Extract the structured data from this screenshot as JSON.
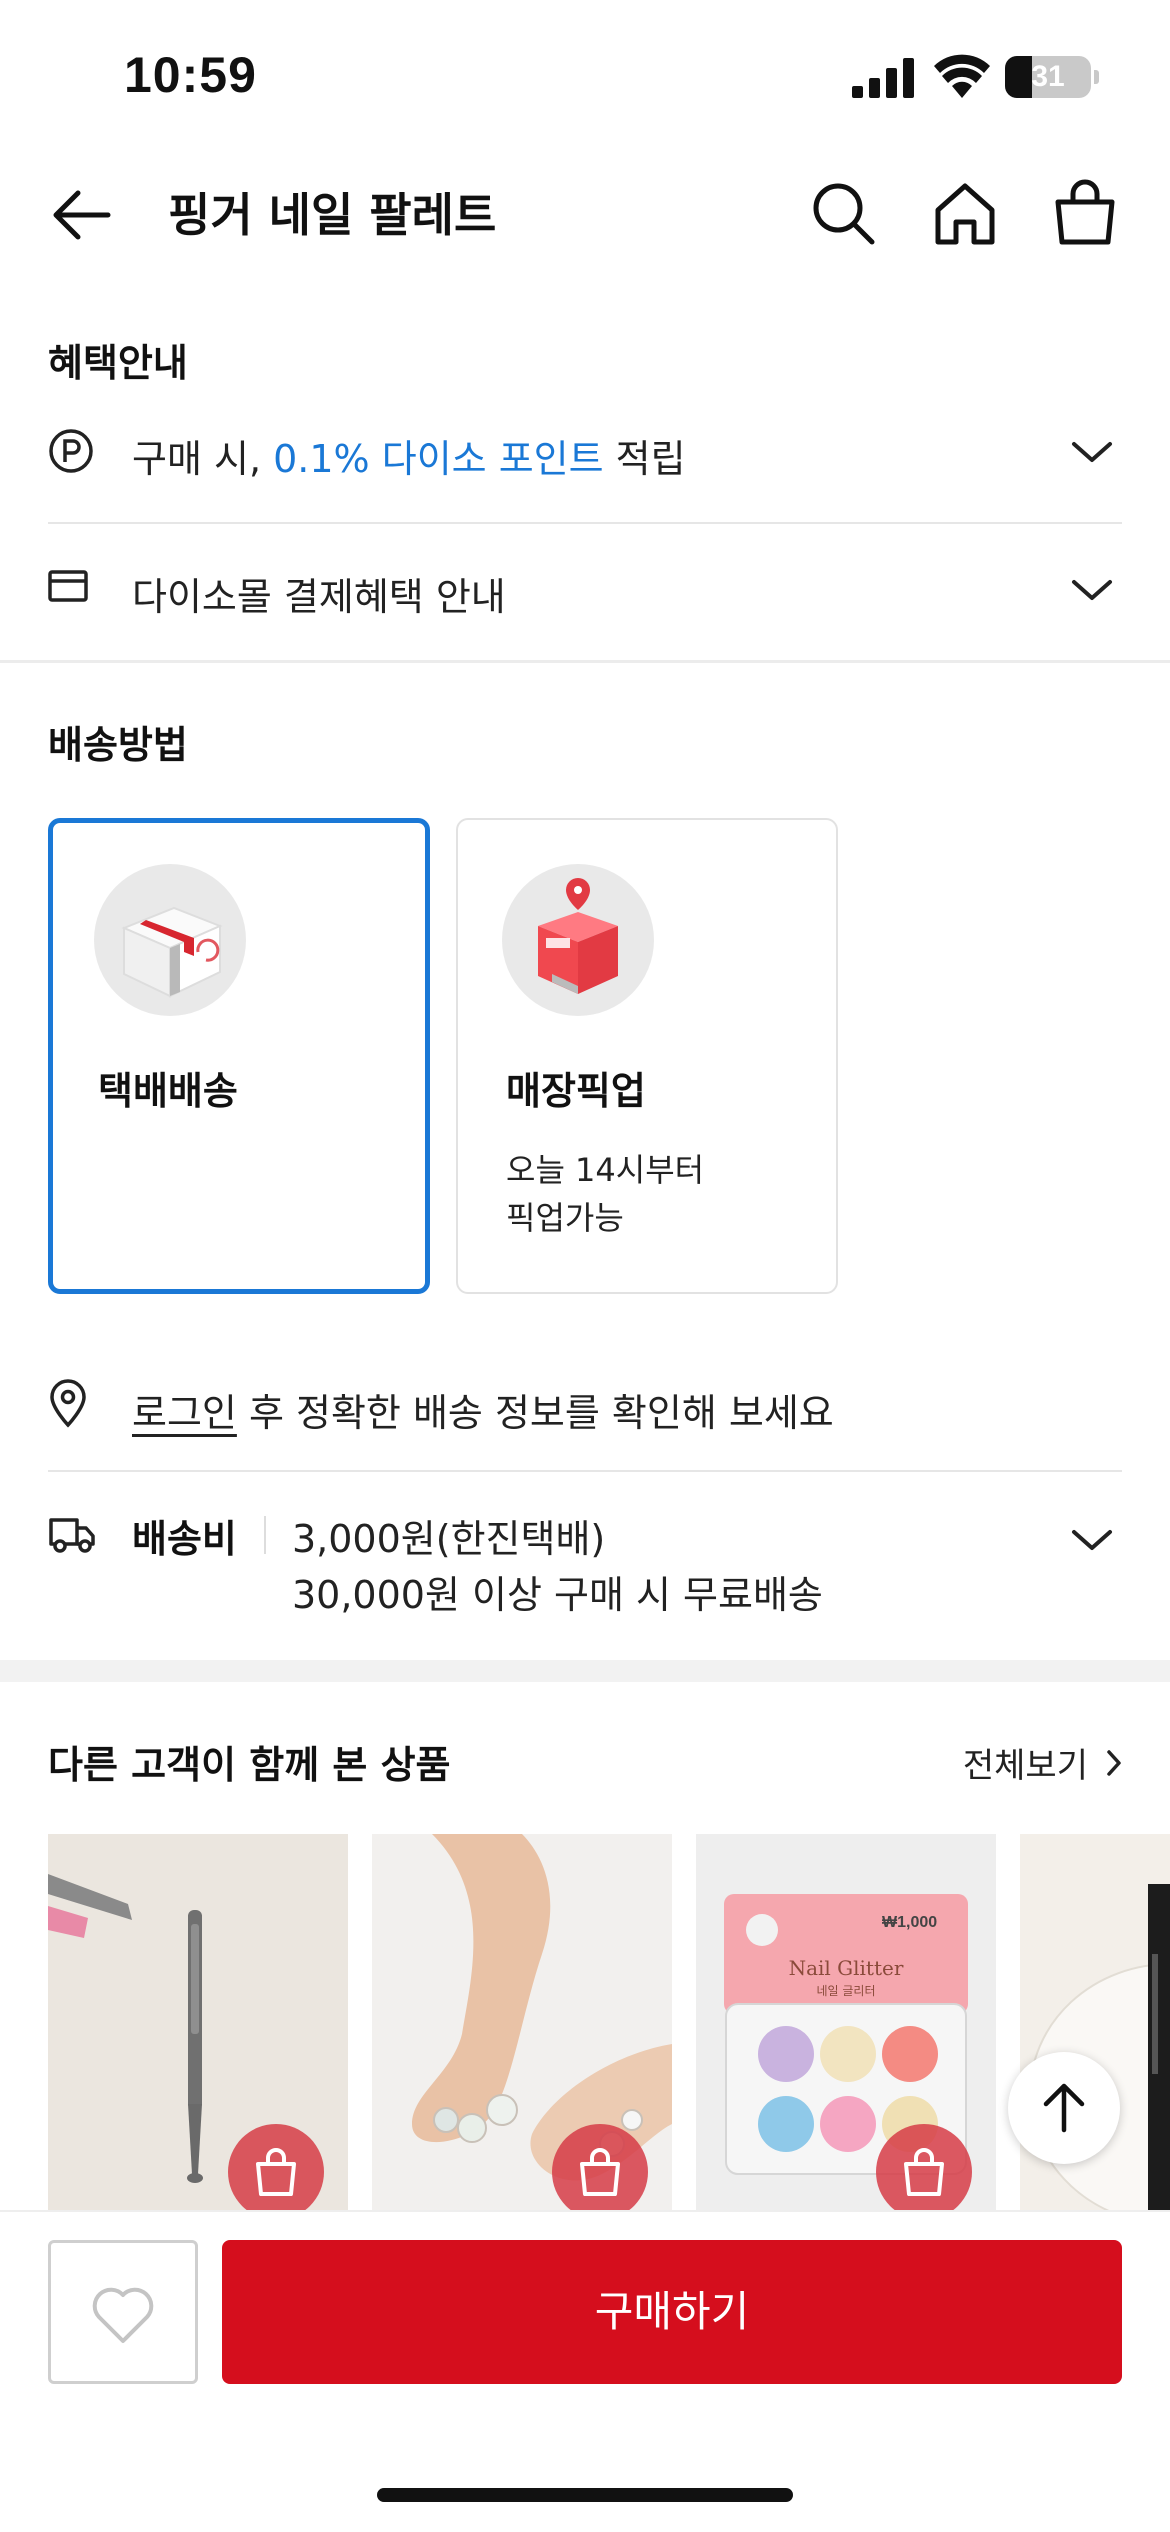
{
  "status_bar": {
    "time": "10:59",
    "battery_level": "31"
  },
  "header": {
    "title": "핑거 네일 팔레트",
    "icons": [
      "back-arrow-icon",
      "search-icon",
      "home-icon",
      "shopping-bag-icon"
    ]
  },
  "benefits": {
    "title": "혜택안내",
    "point_prefix": "구매 시, ",
    "point_highlight": "0.1% 다이소 포인트",
    "point_suffix": " 적립",
    "payment": "다이소몰 결제혜택 안내"
  },
  "shipping": {
    "title": "배송방법",
    "options": [
      {
        "label": "택배배송",
        "sub": "",
        "selected": true
      },
      {
        "label": "매장픽업",
        "sub": "오늘 14시부터\n픽업가능",
        "selected": false
      }
    ],
    "login_link": "로그인",
    "login_rest": " 후 정확한 배송 정보를 확인해 보세요",
    "fee_label": "배송비",
    "fee_line1": "3,000원(한진택배)",
    "fee_line2": "30,000원 이상 구매 시 무료배송"
  },
  "related": {
    "title": "다른 고객이 함께 본 상품",
    "view_all": "전체보기",
    "product_card_badge": "₩1,000",
    "product_card_name": "Nail Glitter",
    "product_card_sub": "네일 글리터"
  },
  "bottom": {
    "buy_label": "구매하기"
  },
  "colors": {
    "accent": "#1a78d6",
    "buy": "#d50e1d"
  }
}
